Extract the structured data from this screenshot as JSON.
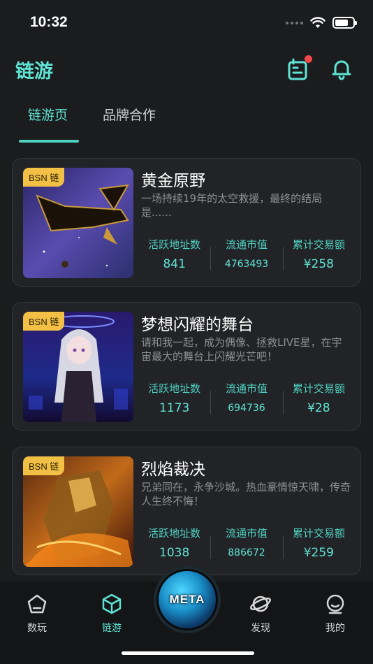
{
  "status_bar": {
    "time": "10:32"
  },
  "header": {
    "title": "链游"
  },
  "tabs": [
    {
      "label": "链游页"
    },
    {
      "label": "品牌合作"
    }
  ],
  "cards": [
    {
      "badge": "BSN 链",
      "title": "黄金原野",
      "desc": "一场持续19年的太空救援，最终的结局是......",
      "stats": [
        {
          "label": "活跃地址数",
          "value": "841"
        },
        {
          "label": "流通市值",
          "value": "4763493"
        },
        {
          "label": "累计交易额",
          "value": "¥258"
        }
      ]
    },
    {
      "badge": "BSN 链",
      "title": "梦想闪耀的舞台",
      "desc": "请和我一起，成为偶像、拯救LIVE星，在宇宙最大的舞台上闪耀光芒吧！",
      "stats": [
        {
          "label": "活跃地址数",
          "value": "1173"
        },
        {
          "label": "流通市值",
          "value": "694736"
        },
        {
          "label": "累计交易额",
          "value": "¥28"
        }
      ]
    },
    {
      "badge": "BSN 链",
      "title": "烈焰裁决",
      "desc": "兄弟同在，永争沙城。热血豪情惊天啸，传奇人生终不悔！",
      "stats": [
        {
          "label": "活跃地址数",
          "value": "1038"
        },
        {
          "label": "流通市值",
          "value": "886672"
        },
        {
          "label": "累计交易额",
          "value": "¥259"
        }
      ]
    }
  ],
  "bottom_nav": {
    "items": [
      {
        "label": "数玩",
        "icon": "pentagon-icon"
      },
      {
        "label": "链游",
        "icon": "cube-icon"
      },
      {
        "label": "发现",
        "icon": "planet-icon"
      },
      {
        "label": "我的",
        "icon": "face-icon"
      }
    ],
    "center_label": "META"
  },
  "colors": {
    "accent": "#5fe3d4",
    "badge": "#f3c046",
    "notification_dot": "#f04848",
    "background": "#1b1c1e"
  }
}
